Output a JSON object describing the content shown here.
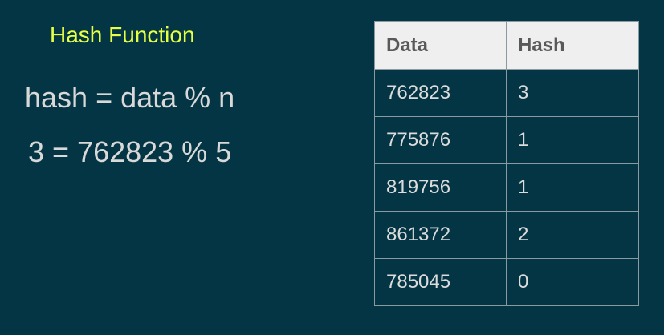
{
  "title": "Hash Function",
  "formula": "hash = data % n",
  "example": "3 = 762823 % 5",
  "table": {
    "headers": [
      "Data",
      "Hash"
    ],
    "rows": [
      [
        "762823",
        "3"
      ],
      [
        "775876",
        "1"
      ],
      [
        "819756",
        "1"
      ],
      [
        "861372",
        "2"
      ],
      [
        "785045",
        "0"
      ]
    ]
  },
  "colors": {
    "background": "#043544",
    "title": "#e6ff45",
    "text": "#d9d9d9",
    "header_bg": "#efefef"
  }
}
